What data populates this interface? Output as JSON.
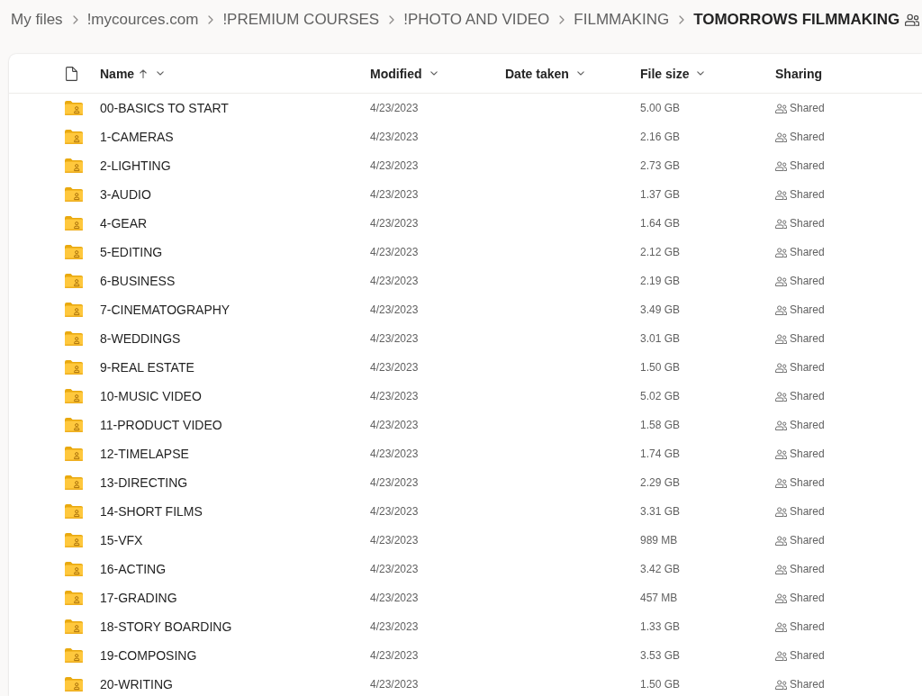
{
  "breadcrumb": [
    {
      "label": "My files",
      "current": false
    },
    {
      "label": "!mycources.com",
      "current": false
    },
    {
      "label": "!PREMIUM COURSES",
      "current": false
    },
    {
      "label": "!PHOTO AND VIDEO",
      "current": false
    },
    {
      "label": "FILMMAKING",
      "current": false
    },
    {
      "label": "TOMORROWS FILMMAKING",
      "current": true
    }
  ],
  "table": {
    "columns": [
      {
        "label": "Name",
        "sorted": true,
        "menu": true
      },
      {
        "label": "Modified",
        "sorted": false,
        "menu": true
      },
      {
        "label": "Date taken",
        "sorted": false,
        "menu": true
      },
      {
        "label": "File size",
        "sorted": false,
        "menu": true
      },
      {
        "label": "Sharing",
        "sorted": false,
        "menu": false
      }
    ],
    "rows": [
      {
        "name": "00-BASICS TO START",
        "modified": "4/23/2023",
        "size": "5.00 GB",
        "sharing": "Shared"
      },
      {
        "name": "1-CAMERAS",
        "modified": "4/23/2023",
        "size": "2.16 GB",
        "sharing": "Shared"
      },
      {
        "name": "2-LIGHTING",
        "modified": "4/23/2023",
        "size": "2.73 GB",
        "sharing": "Shared"
      },
      {
        "name": "3-AUDIO",
        "modified": "4/23/2023",
        "size": "1.37 GB",
        "sharing": "Shared"
      },
      {
        "name": "4-GEAR",
        "modified": "4/23/2023",
        "size": "1.64 GB",
        "sharing": "Shared"
      },
      {
        "name": "5-EDITING",
        "modified": "4/23/2023",
        "size": "2.12 GB",
        "sharing": "Shared"
      },
      {
        "name": "6-BUSINESS",
        "modified": "4/23/2023",
        "size": "2.19 GB",
        "sharing": "Shared"
      },
      {
        "name": "7-CINEMATOGRAPHY",
        "modified": "4/23/2023",
        "size": "3.49 GB",
        "sharing": "Shared"
      },
      {
        "name": "8-WEDDINGS",
        "modified": "4/23/2023",
        "size": "3.01 GB",
        "sharing": "Shared"
      },
      {
        "name": "9-REAL ESTATE",
        "modified": "4/23/2023",
        "size": "1.50 GB",
        "sharing": "Shared"
      },
      {
        "name": "10-MUSIC VIDEO",
        "modified": "4/23/2023",
        "size": "5.02 GB",
        "sharing": "Shared"
      },
      {
        "name": "11-PRODUCT VIDEO",
        "modified": "4/23/2023",
        "size": "1.58 GB",
        "sharing": "Shared"
      },
      {
        "name": "12-TIMELAPSE",
        "modified": "4/23/2023",
        "size": "1.74 GB",
        "sharing": "Shared"
      },
      {
        "name": "13-DIRECTING",
        "modified": "4/23/2023",
        "size": "2.29 GB",
        "sharing": "Shared"
      },
      {
        "name": "14-SHORT FILMS",
        "modified": "4/23/2023",
        "size": "3.31 GB",
        "sharing": "Shared"
      },
      {
        "name": "15-VFX",
        "modified": "4/23/2023",
        "size": "989 MB",
        "sharing": "Shared"
      },
      {
        "name": "16-ACTING",
        "modified": "4/23/2023",
        "size": "3.42 GB",
        "sharing": "Shared"
      },
      {
        "name": "17-GRADING",
        "modified": "4/23/2023",
        "size": "457 MB",
        "sharing": "Shared"
      },
      {
        "name": "18-STORY BOARDING",
        "modified": "4/23/2023",
        "size": "1.33 GB",
        "sharing": "Shared"
      },
      {
        "name": "19-COMPOSING",
        "modified": "4/23/2023",
        "size": "3.53 GB",
        "sharing": "Shared"
      },
      {
        "name": "20-WRITING",
        "modified": "4/23/2023",
        "size": "1.50 GB",
        "sharing": "Shared"
      }
    ]
  }
}
